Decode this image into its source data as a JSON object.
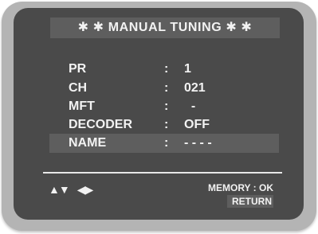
{
  "title": "✱ ✱   MANUAL TUNING   ✱ ✱",
  "menu": [
    {
      "label": "PR",
      "colon": ":",
      "value": "1",
      "highlighted": false
    },
    {
      "label": "CH",
      "colon": ":",
      "value": "021",
      "highlighted": false
    },
    {
      "label": "MFT",
      "colon": ":",
      "value": "  -",
      "highlighted": false
    },
    {
      "label": "DECODER",
      "colon": ":",
      "value": "OFF",
      "highlighted": false
    },
    {
      "label": "NAME",
      "colon": ":",
      "value": "- - - -",
      "highlighted": true
    }
  ],
  "footer": {
    "up_down_keys": "▲▼",
    "left_right_keys": "◀▶",
    "memory": "MEMORY : OK",
    "return": "RETURN"
  },
  "colors": {
    "screen_bg": "#4a4a4a",
    "highlight_bg": "#5e5e5e",
    "bezel": "#b4b4b4",
    "text": "#f2f2f2"
  }
}
